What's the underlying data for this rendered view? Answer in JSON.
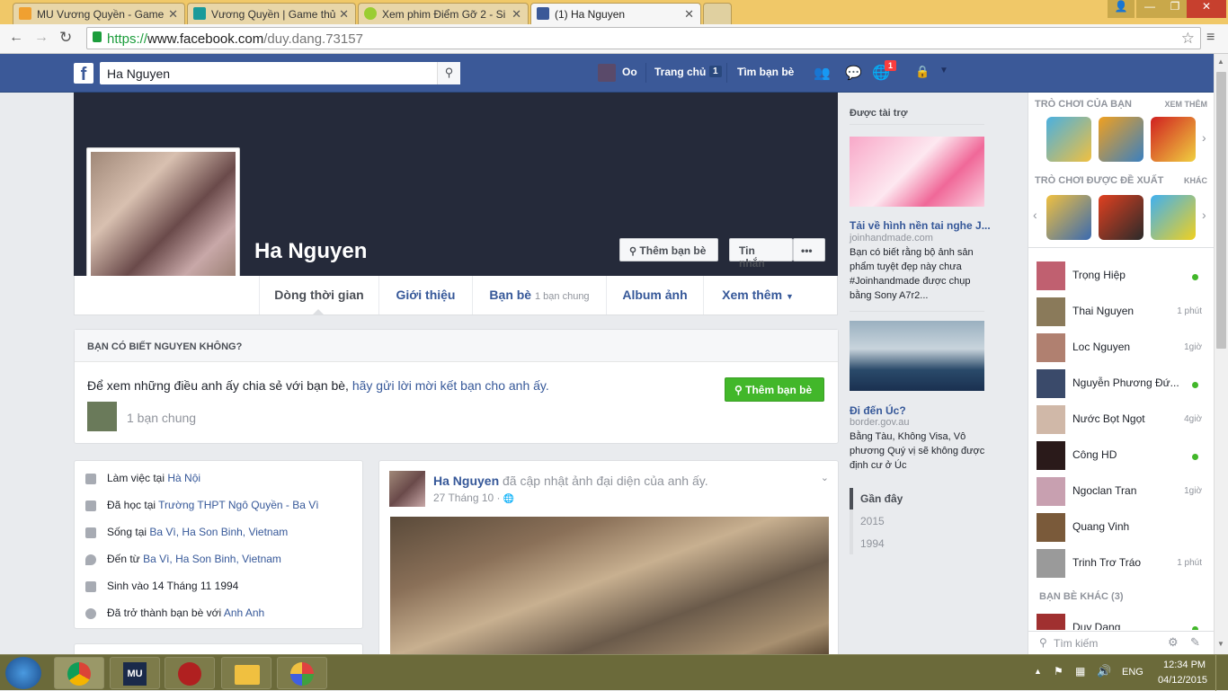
{
  "browser": {
    "tabs": [
      {
        "title": "MU Vương Quyền - Game",
        "color": "#f0a030"
      },
      {
        "title": "Vương Quyền | Game thủ",
        "color": "#1a9a9a"
      },
      {
        "title": "Xem phim Điểm Gỡ 2 - Si",
        "color": "#9acd32"
      },
      {
        "title": "(1) Ha Nguyen",
        "color": "#3b5998"
      }
    ],
    "url_scheme": "https://",
    "url_host": "www.facebook.com",
    "url_path": "/duy.dang.73157"
  },
  "fb": {
    "search_value": "Ha Nguyen",
    "user": "Oo",
    "home_label": "Trang chủ",
    "home_count": "1",
    "find_friends": "Tìm bạn bè",
    "notif_count": "1"
  },
  "profile": {
    "name": "Ha Nguyen",
    "add_friend": "Thêm bạn bè",
    "message": "Tin nhắn",
    "more_dots": "•••",
    "nav": {
      "timeline": "Dòng thời gian",
      "about": "Giới thiệu",
      "friends": "Bạn bè",
      "mutual": "1 bạn chung",
      "photos": "Album ảnh",
      "more": "Xem thêm"
    }
  },
  "know": {
    "header": "BẠN CÓ BIẾT NGUYEN KHÔNG?",
    "text": "Để xem những điều anh ấy chia sẻ với bạn bè,",
    "link": "hãy gửi lời mời kết bạn cho anh ấy.",
    "mutual": "1 bạn chung",
    "button": "Thêm bạn bè"
  },
  "intro": [
    {
      "label": "Làm việc tại",
      "link": "Hà Nội",
      "icon": "briefcase-icon"
    },
    {
      "label": "Đã học tại",
      "link": "Trường THPT Ngô Quyền - Ba Vì",
      "icon": "graduation-icon"
    },
    {
      "label": "Sống tại",
      "link": "Ba Vì, Ha Son Binh, Vietnam",
      "icon": "home-icon"
    },
    {
      "label": "Đến từ",
      "link": "Ba Vì, Ha Son Binh, Vietnam",
      "icon": "pin-icon"
    },
    {
      "label": "Sinh vào 14 Tháng 11 1994",
      "link": "",
      "icon": "calendar-icon"
    },
    {
      "label": "Đã trở thành bạn bè với",
      "link": "Anh Anh",
      "icon": "people-icon"
    }
  ],
  "post": {
    "author": "Ha Nguyen",
    "action": "đã cập nhật ảnh đại diện của anh ấy.",
    "time": "27 Tháng 10 ·"
  },
  "sponsored": {
    "header": "Được tài trợ",
    "ads": [
      {
        "title": "Tải về hình nền tai nghe J...",
        "domain": "joinhandmade.com",
        "text": "Bạn có biết rằng bộ ảnh sản phẩm tuyệt đẹp này chưa #Joinhandmade được chụp bằng Sony A7r2..."
      },
      {
        "title": "Đi đến Úc?",
        "domain": "border.gov.au",
        "text": "Bằng Tàu, Không Visa, Vô phương Quý vị sẽ không được định cư ở Úc"
      }
    ],
    "years": [
      "Gần đây",
      "2015",
      "1994"
    ]
  },
  "chat": {
    "games_header": "TRÒ CHƠI CỦA BẠN",
    "games_more": "XEM THÊM",
    "suggested_header": "TRÒ CHƠI ĐƯỢC ĐỀ XUẤT",
    "suggested_more": "KHÁC",
    "friends": [
      {
        "name": "Trọng Hiệp",
        "status": ""
      },
      {
        "name": "Thai Nguyen",
        "status": "1 phút"
      },
      {
        "name": "Loc Nguyen",
        "status": "1giờ"
      },
      {
        "name": "Nguyễn Phương Đứ...",
        "status": ""
      },
      {
        "name": "Nước Bọt Ngọt",
        "status": "4giờ"
      },
      {
        "name": "Công HD",
        "status": ""
      },
      {
        "name": "Ngoclan Tran",
        "status": "1giờ"
      },
      {
        "name": "Quang Vinh",
        "status": ""
      },
      {
        "name": "Trinh Trơ Tráo",
        "status": "1 phút"
      }
    ],
    "other_header": "BẠN BÈ KHÁC (3)",
    "other_first": "Duy Dang",
    "search_placeholder": "Tìm kiếm"
  },
  "taskbar": {
    "lang": "ENG",
    "time": "12:34 PM",
    "date": "04/12/2015"
  }
}
